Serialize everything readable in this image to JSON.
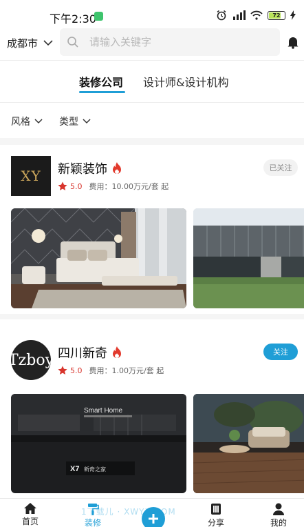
{
  "status": {
    "time": "下午2:30",
    "battery": "72"
  },
  "header": {
    "city": "成都市",
    "search_placeholder": "请输入关键字"
  },
  "tabs": [
    {
      "label": "装修公司"
    },
    {
      "label": "设计师&设计机构"
    }
  ],
  "filters": [
    {
      "label": "风格"
    },
    {
      "label": "类型"
    }
  ],
  "companies": [
    {
      "name": "新颖装饰",
      "logo_text": "XY",
      "score": "5.0",
      "fee": "费用：10.00万元/套 起",
      "follow": "已关注"
    },
    {
      "name": "四川新奇",
      "logo_text": "Tzboy",
      "score": "5.0",
      "fee": "费用：1.00万元/套 起",
      "follow": "关注"
    }
  ],
  "showcase": {
    "brand_title": "Smart Home",
    "brand_logo": "新奇之家"
  },
  "bottom_nav": [
    {
      "label": "首页"
    },
    {
      "label": "装修"
    },
    {
      "label": "分享"
    },
    {
      "label": "我的"
    }
  ],
  "watermark": "1下载儿 · XWYX.COM",
  "colors": {
    "accent": "#1f9ed6",
    "rating": "#d8342c"
  }
}
